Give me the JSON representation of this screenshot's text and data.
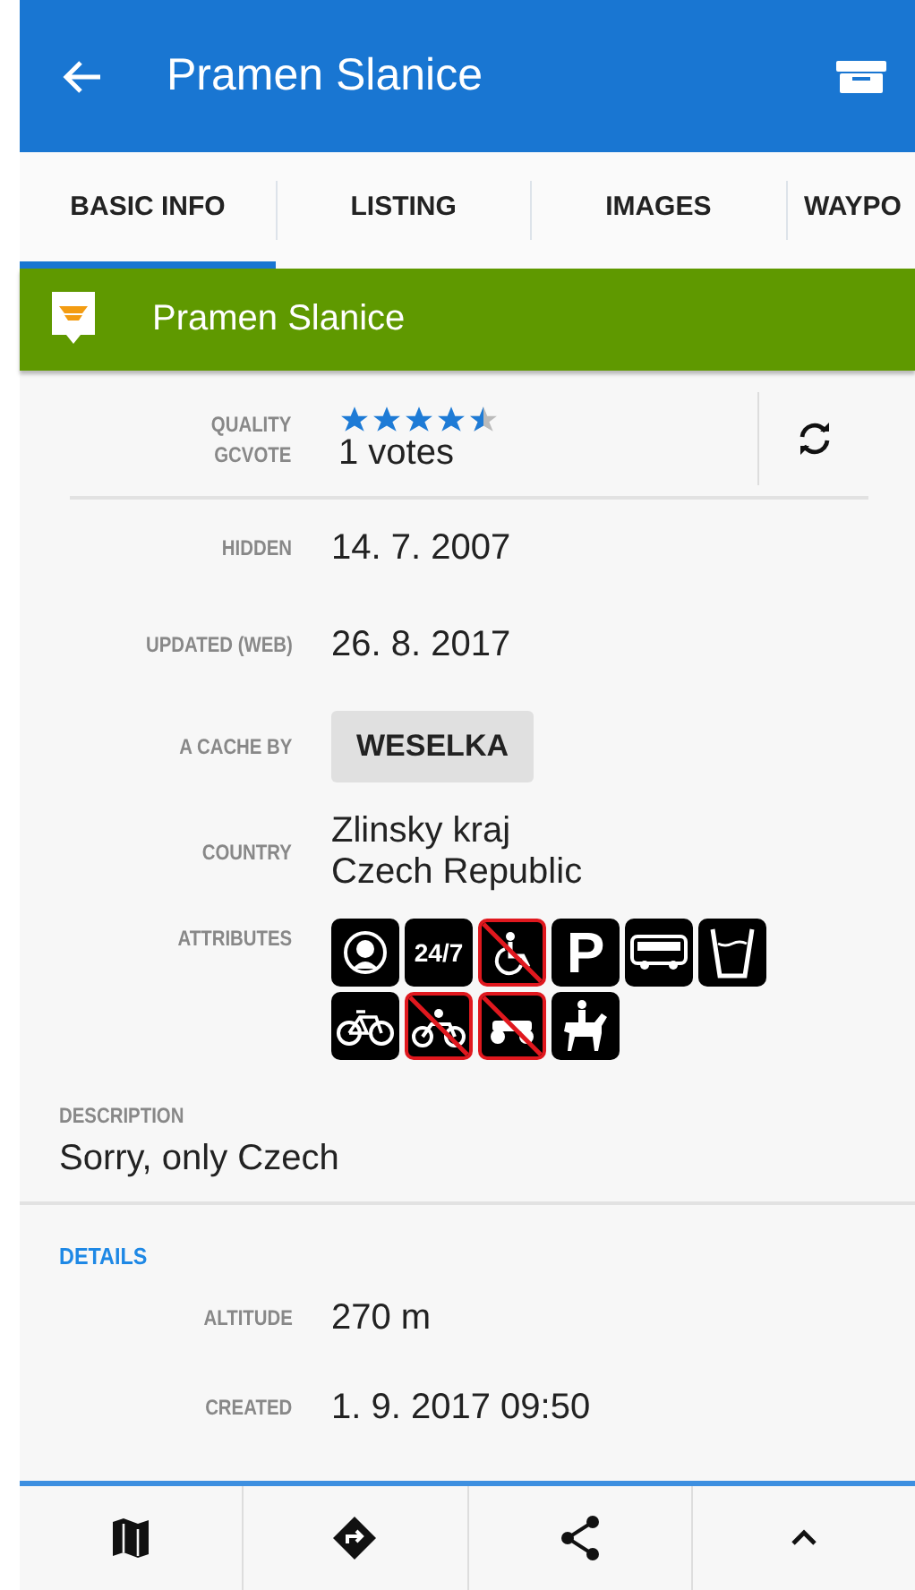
{
  "app_bar": {
    "title": "Pramen Slanice"
  },
  "tabs": [
    {
      "label": "BASIC INFO",
      "selected": true
    },
    {
      "label": "LISTING",
      "selected": false
    },
    {
      "label": "IMAGES",
      "selected": false
    },
    {
      "label": "WAYPO",
      "selected": false
    }
  ],
  "cache_bar": {
    "name": "Pramen Slanice"
  },
  "rating": {
    "label_1": "QUALITY",
    "label_2": "GCVOTE",
    "stars": 4.5,
    "votes": "1 votes"
  },
  "fields": [
    {
      "label": "HIDDEN",
      "value": "14. 7. 2007"
    },
    {
      "label": "UPDATED (WEB)",
      "value": "26. 8. 2017"
    }
  ],
  "owner": {
    "label": "A CACHE BY",
    "value": "WESELKA"
  },
  "country": {
    "label": "COUNTRY",
    "lines": [
      "Zlinsky kraj",
      "Czech Republic"
    ]
  },
  "attributes": {
    "label": "ATTRIBUTES",
    "items": [
      {
        "kind": "kids",
        "crossed": false
      },
      {
        "kind": "text",
        "label": "24/7",
        "crossed": false
      },
      {
        "kind": "wheelchair",
        "crossed": true
      },
      {
        "kind": "bigtext",
        "label": "P",
        "crossed": false
      },
      {
        "kind": "bus",
        "crossed": false
      },
      {
        "kind": "water",
        "crossed": false
      },
      {
        "kind": "bicycle",
        "crossed": false
      },
      {
        "kind": "motorcycle",
        "crossed": true
      },
      {
        "kind": "quad",
        "crossed": true
      },
      {
        "kind": "horse",
        "crossed": false
      }
    ]
  },
  "description": {
    "label": "DESCRIPTION",
    "text": "Sorry, only Czech"
  },
  "details": {
    "heading": "DETAILS",
    "fields": [
      {
        "label": "ALTITUDE",
        "value": "270 m"
      },
      {
        "label": "CREATED",
        "value": "1. 9. 2017 09:50"
      }
    ]
  }
}
